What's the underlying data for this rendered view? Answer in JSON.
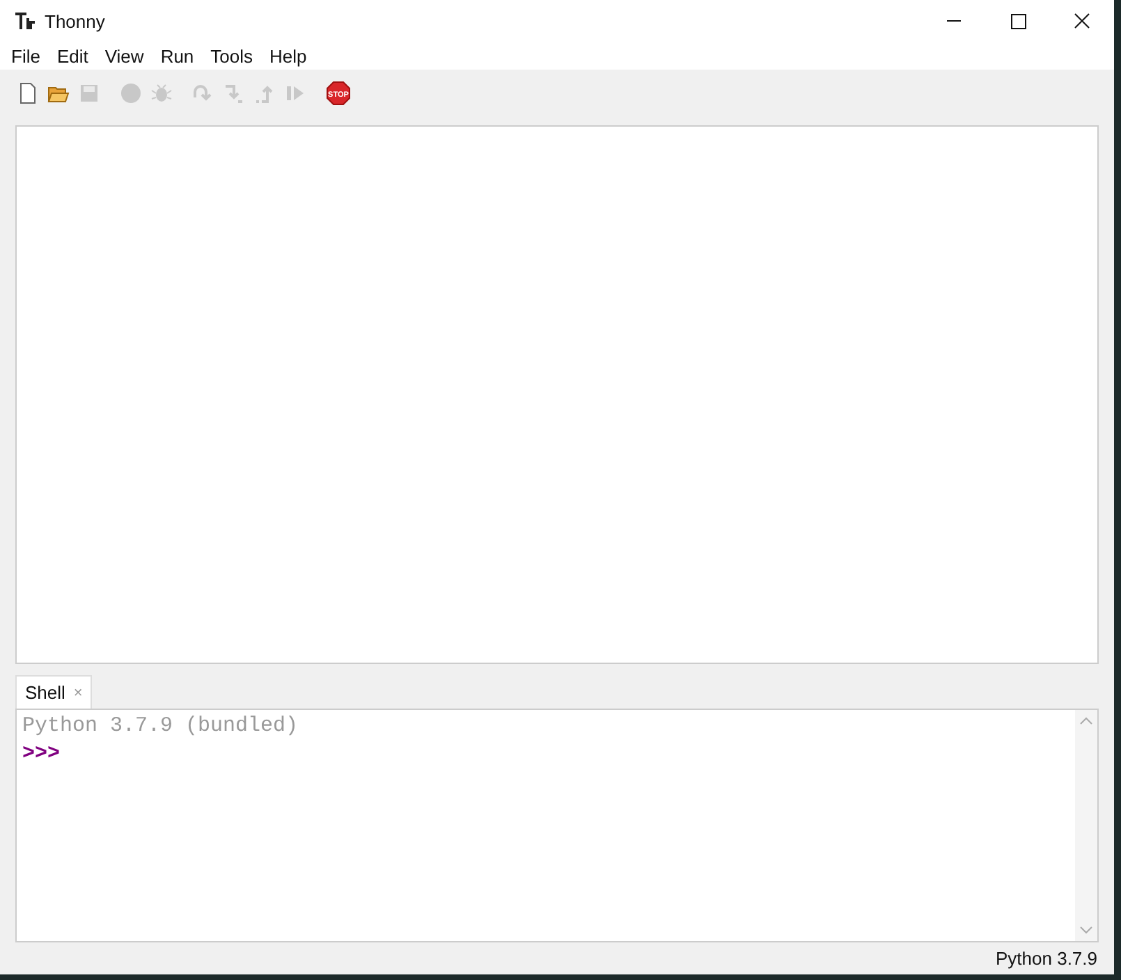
{
  "window": {
    "title": "Thonny"
  },
  "menu": [
    "File",
    "Edit",
    "View",
    "Run",
    "Tools",
    "Help"
  ],
  "toolbar": [
    {
      "kind": "new",
      "disabled": false
    },
    {
      "kind": "open",
      "disabled": false
    },
    {
      "kind": "save",
      "disabled": true
    },
    {
      "kind": "run",
      "disabled": true
    },
    {
      "kind": "debug",
      "disabled": true
    },
    {
      "kind": "step-over",
      "disabled": true
    },
    {
      "kind": "step-into",
      "disabled": true
    },
    {
      "kind": "step-out",
      "disabled": true
    },
    {
      "kind": "resume",
      "disabled": true
    },
    {
      "kind": "stop",
      "disabled": false,
      "label": "STOP"
    }
  ],
  "shell": {
    "tab": {
      "label": "Shell",
      "close": "×",
      "selected": true
    },
    "lines": [
      {
        "kind": "info",
        "text": "Python 3.7.9 (bundled)"
      },
      {
        "kind": "prompt",
        "text": ">>>"
      }
    ]
  },
  "status_bar": "Python 3.7.9"
}
